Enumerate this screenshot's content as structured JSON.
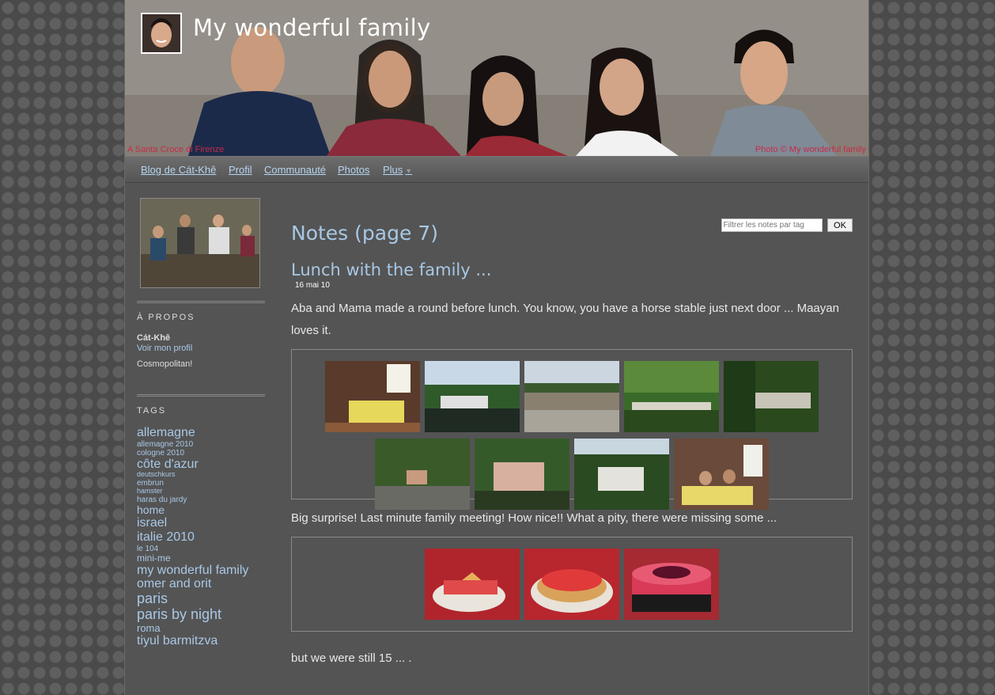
{
  "site": {
    "title": "My wonderful family"
  },
  "banner": {
    "caption": "A Santa Croce di Firenze",
    "credit": "Photo © My wonderful family"
  },
  "nav": {
    "items": [
      {
        "label": "Blog de Cát-Khê"
      },
      {
        "label": "Profil"
      },
      {
        "label": "Communauté"
      },
      {
        "label": "Photos"
      },
      {
        "label": "Plus"
      }
    ]
  },
  "sidebar": {
    "about": {
      "heading": "À PROPOS",
      "name": "Cát-Khê",
      "profile_link": "Voir mon profil",
      "description": "Cosmopolitan!"
    },
    "tags": {
      "heading": "TAGS",
      "items": [
        {
          "label": "allemagne",
          "size": 16
        },
        {
          "label": "allemagne 2010",
          "size": 10
        },
        {
          "label": "cologne 2010",
          "size": 10
        },
        {
          "label": "côte d'azur",
          "size": 16
        },
        {
          "label": "deutschkurs",
          "size": 9
        },
        {
          "label": "embrun",
          "size": 10
        },
        {
          "label": "hamster",
          "size": 9
        },
        {
          "label": "haras du jardy",
          "size": 10
        },
        {
          "label": "home",
          "size": 14
        },
        {
          "label": "israel",
          "size": 16
        },
        {
          "label": "italie 2010",
          "size": 16
        },
        {
          "label": "le 104",
          "size": 10
        },
        {
          "label": "mini-me",
          "size": 12
        },
        {
          "label": "my wonderful family",
          "size": 16
        },
        {
          "label": "omer and orit",
          "size": 16
        },
        {
          "label": "paris",
          "size": 18
        },
        {
          "label": "paris by night",
          "size": 18
        },
        {
          "label": "roma",
          "size": 13
        },
        {
          "label": "tiyul barmitzva",
          "size": 16
        }
      ]
    }
  },
  "main": {
    "filter": {
      "placeholder": "Filtrer les notes par tag",
      "button": "OK"
    },
    "page_title": "Notes (page 7)",
    "post": {
      "title": "Lunch with the family ...",
      "date": "16 mai 10",
      "para1": "Aba and Mama made a round before lunch. You know, you have a horse stable just next door ... Maayan loves it.",
      "para2": "Big surprise! Last minute family meeting! How nice!! What a pity, there were missing some ...",
      "para3": "but we were still 15 ... ."
    }
  },
  "colors": {
    "link": "#a9c8e6",
    "title": "#a8c8e4",
    "caption": "#c82a4a"
  }
}
